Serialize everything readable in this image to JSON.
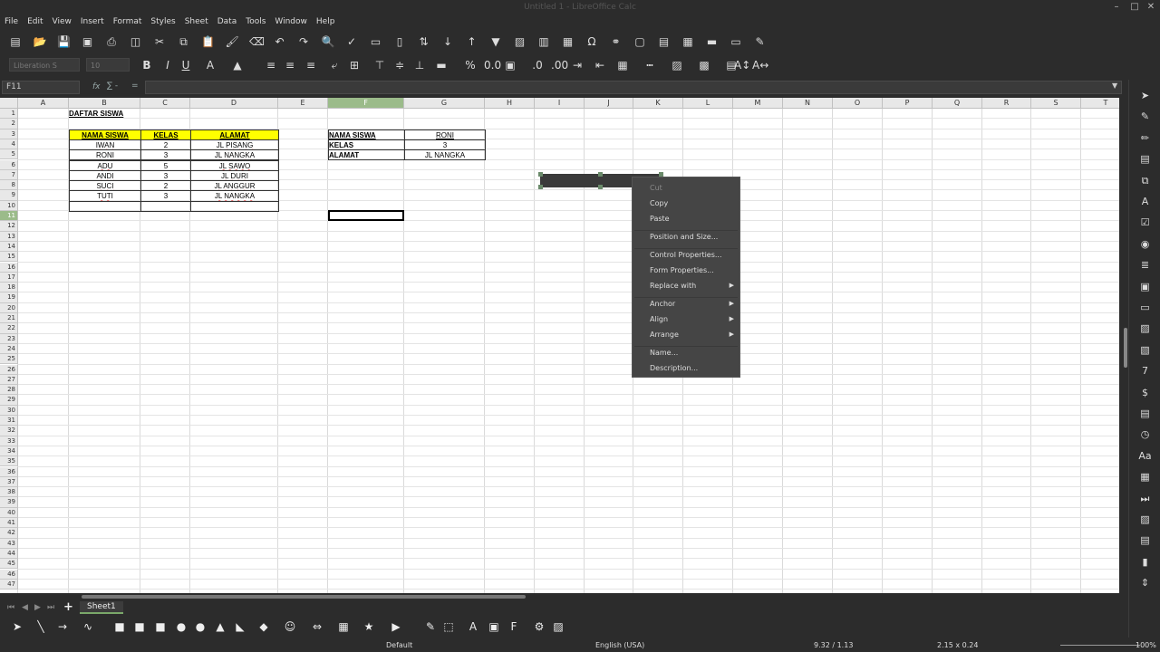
{
  "window": {
    "title": "Untitled 1 - LibreOffice Calc"
  },
  "menu": [
    "File",
    "Edit",
    "View",
    "Insert",
    "Format",
    "Styles",
    "Sheet",
    "Data",
    "Tools",
    "Window",
    "Help"
  ],
  "font": {
    "name": "Liberation S",
    "size": "10"
  },
  "formula_bar": {
    "cell_ref": "F11",
    "fx": "fx",
    "sigma": "∑ -",
    "equals": "=",
    "content": ""
  },
  "columns": [
    "A",
    "B",
    "C",
    "D",
    "E",
    "F",
    "G",
    "H",
    "I",
    "J",
    "K",
    "L",
    "M",
    "N",
    "O",
    "P",
    "Q",
    "R",
    "S",
    "T"
  ],
  "selected_column": "F",
  "selected_row": "11",
  "rows": [
    "1",
    "2",
    "3",
    "4",
    "5",
    "6",
    "7",
    "8",
    "9",
    "10",
    "11",
    "12",
    "13",
    "14",
    "15",
    "16",
    "17",
    "18",
    "19",
    "20",
    "21",
    "22",
    "23",
    "24",
    "25",
    "26",
    "27",
    "28",
    "29",
    "30",
    "31",
    "32",
    "33",
    "34",
    "35",
    "36",
    "37",
    "38",
    "39",
    "40",
    "41",
    "42",
    "43",
    "44",
    "45",
    "46",
    "47"
  ],
  "table1": {
    "title": "DAFTAR SISWA",
    "headers": [
      "NAMA SISWA",
      "KELAS",
      "ALAMAT"
    ],
    "rows": [
      [
        "IWAN",
        "2",
        "JL PISANG"
      ],
      [
        "RONI",
        "3",
        "JL NANGKA"
      ],
      [
        "ADU",
        "5",
        "JL SAWO"
      ],
      [
        "ANDI",
        "3",
        "JL DURI"
      ],
      [
        "SUCI",
        "2",
        "JL ANGGUR"
      ],
      [
        "TUTI",
        "3",
        "JL NANGKA"
      ],
      [
        "",
        "",
        ""
      ]
    ]
  },
  "table2": {
    "rows": [
      [
        "NAMA SISWA",
        "RONI"
      ],
      [
        "KELAS",
        "3"
      ],
      [
        "ALAMAT",
        "JL NANGKA"
      ]
    ]
  },
  "context_menu": {
    "items": [
      {
        "label": "Cut",
        "disabled": true,
        "submenu": false
      },
      {
        "label": "Copy",
        "disabled": false,
        "submenu": false
      },
      {
        "label": "Paste",
        "disabled": false,
        "submenu": false
      },
      {
        "label": "Position and Size...",
        "disabled": false,
        "submenu": false
      },
      {
        "label": "Control Properties...",
        "disabled": false,
        "submenu": false
      },
      {
        "label": "Form Properties...",
        "disabled": false,
        "submenu": false
      },
      {
        "label": "Replace with",
        "disabled": false,
        "submenu": true
      },
      {
        "label": "Anchor",
        "disabled": false,
        "submenu": true
      },
      {
        "label": "Align",
        "disabled": false,
        "submenu": true
      },
      {
        "label": "Arrange",
        "disabled": false,
        "submenu": true
      },
      {
        "label": "Name...",
        "disabled": false,
        "submenu": false
      },
      {
        "label": "Description...",
        "disabled": false,
        "submenu": false
      }
    ]
  },
  "sheet_tabs": {
    "active": "Sheet1"
  },
  "status": {
    "page_style": "Default",
    "language": "English (USA)",
    "position": "9.32 / 1.13",
    "size": "2.15 x 0.24",
    "zoom": "100%"
  }
}
